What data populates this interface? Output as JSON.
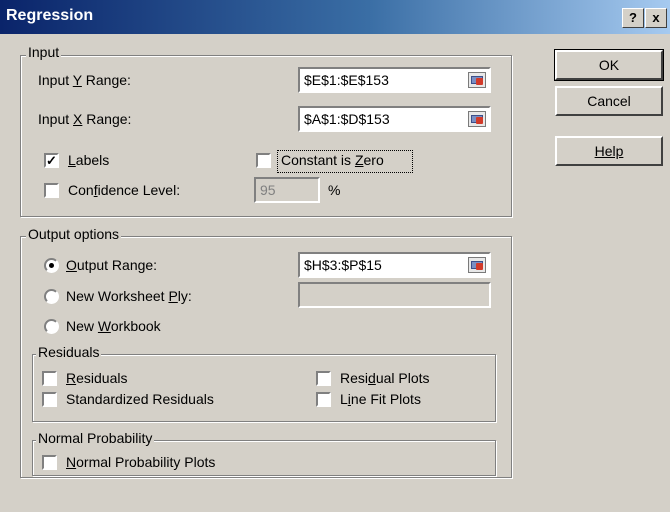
{
  "window": {
    "title": "Regression",
    "help_glyph": "?",
    "close_glyph": "x"
  },
  "buttons": {
    "ok": "OK",
    "cancel": "Cancel",
    "help": "Help"
  },
  "input": {
    "legend": "Input",
    "y_label_pre": "Input ",
    "y_label_key": "Y",
    "y_label_post": " Range:",
    "y_value": "$E$1:$E$153",
    "x_label_pre": "Input ",
    "x_label_key": "X",
    "x_label_post": " Range:",
    "x_value": "$A$1:$D$153",
    "labels_key": "L",
    "labels_rest": "abels",
    "labels_checked": true,
    "constant_pre": "Constant is ",
    "constant_key": "Z",
    "constant_post": "ero",
    "constant_checked": false,
    "confidence_pre": "Con",
    "confidence_key": "f",
    "confidence_post": "idence Level:",
    "confidence_checked": false,
    "confidence_value": "95",
    "percent": "%"
  },
  "output": {
    "legend": "Output options",
    "output_range_key": "O",
    "output_range_rest": "utput Range:",
    "output_range_value": "$H$3:$P$15",
    "new_worksheet_pre": "New Worksheet ",
    "new_worksheet_key": "P",
    "new_worksheet_post": "ly:",
    "new_workbook_pre": "New ",
    "new_workbook_key": "W",
    "new_workbook_post": "orkbook",
    "selected": "output_range"
  },
  "residuals": {
    "legend": "Residuals",
    "residuals_key": "R",
    "residuals_rest": "esiduals",
    "standardized_key": "T",
    "standardized_rest": "Standardized Residuals",
    "residual_plots_pre": "Resi",
    "residual_plots_key": "d",
    "residual_plots_post": "ual Plots",
    "line_fit_pre": "L",
    "line_fit_key": "i",
    "line_fit_post": "ne Fit Plots"
  },
  "normal": {
    "legend": "Normal Probability",
    "plots_key": "N",
    "plots_rest": "ormal Probability Plots"
  },
  "colors": {
    "title_start": "#0a246a",
    "title_end": "#a6caf0",
    "face": "#d4d0c8"
  }
}
